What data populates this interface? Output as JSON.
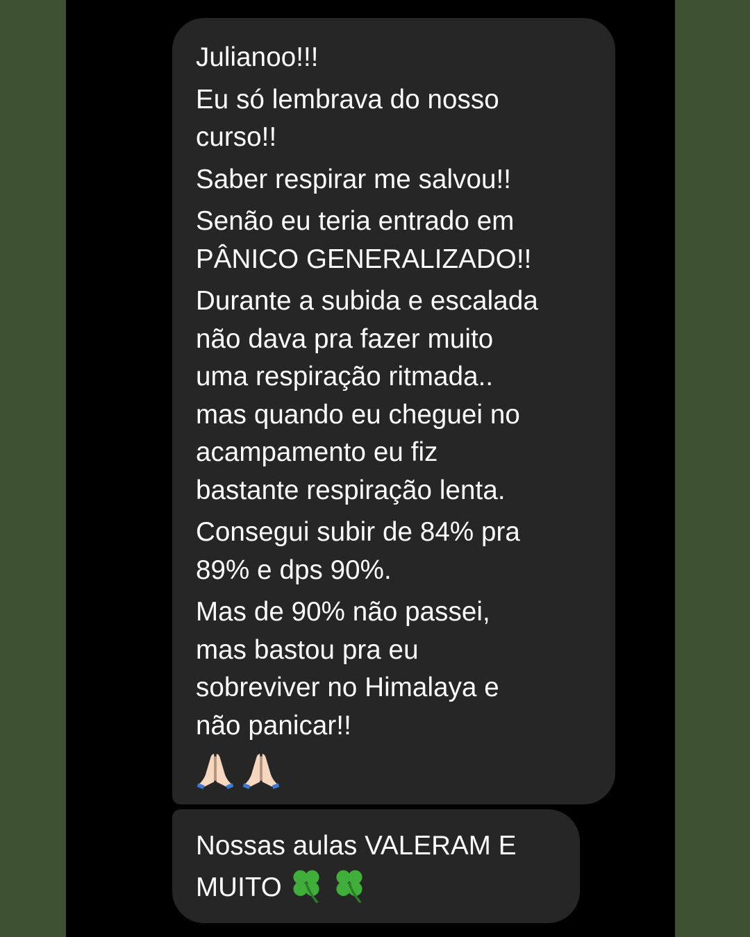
{
  "messages": [
    {
      "lines": [
        "Julianoo!!!",
        "Eu só lembrava do nosso",
        "curso!!",
        "Saber respirar me salvou!!",
        "Senão eu teria entrado em",
        "PÂNICO GENERALIZADO!!",
        "Durante a subida e escalada",
        "não dava pra fazer muito",
        "uma respiração ritmada..",
        "mas quando eu cheguei no",
        "acampamento eu fiz",
        "bastante respiração lenta.",
        "Consegui subir de 84% pra",
        "89% e dps 90%.",
        "Mas de 90% não passei,",
        "mas bastou pra eu",
        "sobreviver no Himalaya e",
        "não panicar!!"
      ],
      "emojis": [
        "folded-hands-icon",
        "folded-hands-icon"
      ]
    },
    {
      "lines": [
        "Nossas aulas VALERAM E",
        "MUITO"
      ],
      "emojis": [
        "four-leaf-clover-icon",
        "four-leaf-clover-icon"
      ]
    }
  ],
  "colors": {
    "outer_background": "#3f5133",
    "screen_background": "#000000",
    "bubble_background": "#262626",
    "text": "#ffffff"
  }
}
